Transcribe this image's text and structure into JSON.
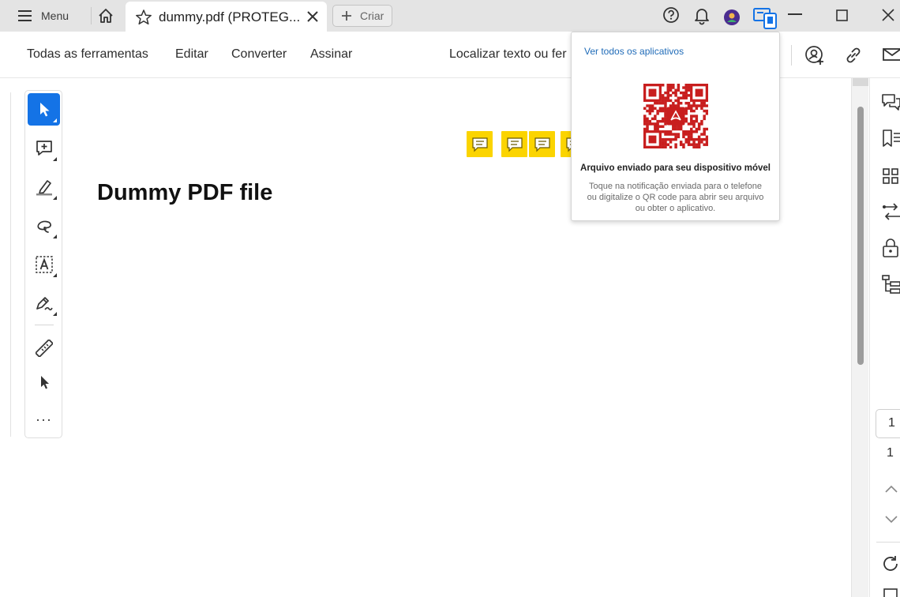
{
  "titlebar": {
    "menu_label": "Menu",
    "tab_title": "dummy.pdf (PROTEG...",
    "new_tab_label": "Criar",
    "icons": [
      "hamburger-icon",
      "home-icon",
      "star-icon",
      "close-icon",
      "plus-icon",
      "help-icon",
      "bell-icon",
      "avatar-icon",
      "send-to-device-icon",
      "minimize-icon",
      "maximize-icon",
      "window-close-icon"
    ]
  },
  "toolbar": {
    "all_tools": "Todas as ferramentas",
    "edit": "Editar",
    "convert": "Converter",
    "sign": "Assinar",
    "search": "Localizar texto ou fer",
    "icons": [
      "share-user-icon",
      "link-icon",
      "mail-icon"
    ]
  },
  "left_panel": {
    "tools": [
      "select-icon",
      "add-comment-icon",
      "highlight-icon",
      "draw-icon",
      "text-select-icon",
      "sign-pen-icon",
      "measure-icon",
      "pointer-icon",
      "more-icon"
    ],
    "more_label": "···"
  },
  "document": {
    "heading": "Dummy PDF file",
    "comment_count": 5
  },
  "popup": {
    "link": "Ver todos os aplicativos",
    "title": "Arquivo enviado para seu dispositivo móvel",
    "body": "Toque na notificação enviada para o telefone ou digitalize o QR code para abrir seu arquivo ou obter o aplicativo."
  },
  "right_rail": {
    "icons": [
      "comments-icon",
      "bookmarks-icon",
      "grid-icon",
      "compare-icon",
      "lock-icon",
      "organize-icon",
      "chevron-up-icon",
      "chevron-down-icon",
      "rotate-icon"
    ],
    "current_page": "1",
    "total_pages": "1"
  },
  "colors": {
    "accent": "#1473e6",
    "comment": "#fbd400",
    "qr": "#c81e1e",
    "link": "#1f6bb8"
  }
}
